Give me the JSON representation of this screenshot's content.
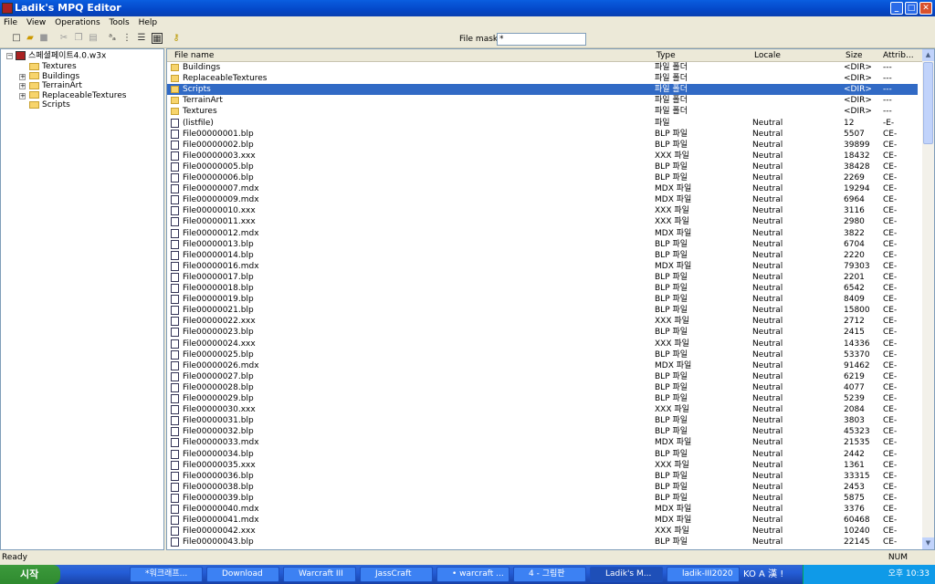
{
  "window": {
    "title": "Ladik's MPQ Editor",
    "min": "_",
    "max": "□",
    "close": "✕"
  },
  "menu": [
    "File",
    "View",
    "Operations",
    "Tools",
    "Help"
  ],
  "toolbar": {
    "icons": [
      "new-icon",
      "open-icon",
      "save-icon",
      "cut-icon",
      "copy-icon",
      "paste-icon",
      "small-icons-icon",
      "list-icon",
      "details-icon",
      "grid-icon",
      "key-icon"
    ],
    "file_mask_label": "File mask :",
    "file_mask_value": "*"
  },
  "tree": {
    "root": "스페셜페이트4.0.w3x",
    "children": [
      {
        "label": "Textures",
        "expandable": false
      },
      {
        "label": "Buildings",
        "expandable": true
      },
      {
        "label": "TerrainArt",
        "expandable": true
      },
      {
        "label": "ReplaceableTextures",
        "expandable": true
      },
      {
        "label": "Scripts",
        "expandable": false
      }
    ]
  },
  "columns": {
    "name": "File name",
    "type": "Type",
    "locale": "Locale",
    "size": "Size",
    "attrib": "Attrib..."
  },
  "rows": [
    {
      "name": "Buildings",
      "type": "파일 폴더",
      "locale": "",
      "size": "<DIR>",
      "attrib": "---",
      "folder": true
    },
    {
      "name": "ReplaceableTextures",
      "type": "파일 폴더",
      "locale": "",
      "size": "<DIR>",
      "attrib": "---",
      "folder": true
    },
    {
      "name": "Scripts",
      "type": "파일 폴더",
      "locale": "",
      "size": "<DIR>",
      "attrib": "---",
      "folder": true,
      "selected": true
    },
    {
      "name": "TerrainArt",
      "type": "파일 폴더",
      "locale": "",
      "size": "<DIR>",
      "attrib": "---",
      "folder": true
    },
    {
      "name": "Textures",
      "type": "파일 폴더",
      "locale": "",
      "size": "<DIR>",
      "attrib": "---",
      "folder": true
    },
    {
      "name": "(listfile)",
      "type": "파일",
      "locale": "Neutral",
      "size": "12",
      "attrib": "-E-"
    },
    {
      "name": "File00000001.blp",
      "type": "BLP 파일",
      "locale": "Neutral",
      "size": "5507",
      "attrib": "CE-"
    },
    {
      "name": "File00000002.blp",
      "type": "BLP 파일",
      "locale": "Neutral",
      "size": "39899",
      "attrib": "CE-"
    },
    {
      "name": "File00000003.xxx",
      "type": "XXX 파일",
      "locale": "Neutral",
      "size": "18432",
      "attrib": "CE-"
    },
    {
      "name": "File00000005.blp",
      "type": "BLP 파일",
      "locale": "Neutral",
      "size": "38428",
      "attrib": "CE-"
    },
    {
      "name": "File00000006.blp",
      "type": "BLP 파일",
      "locale": "Neutral",
      "size": "2269",
      "attrib": "CE-"
    },
    {
      "name": "File00000007.mdx",
      "type": "MDX 파일",
      "locale": "Neutral",
      "size": "19294",
      "attrib": "CE-"
    },
    {
      "name": "File00000009.mdx",
      "type": "MDX 파일",
      "locale": "Neutral",
      "size": "6964",
      "attrib": "CE-"
    },
    {
      "name": "File00000010.xxx",
      "type": "XXX 파일",
      "locale": "Neutral",
      "size": "3116",
      "attrib": "CE-"
    },
    {
      "name": "File00000011.xxx",
      "type": "XXX 파일",
      "locale": "Neutral",
      "size": "2980",
      "attrib": "CE-"
    },
    {
      "name": "File00000012.mdx",
      "type": "MDX 파일",
      "locale": "Neutral",
      "size": "3822",
      "attrib": "CE-"
    },
    {
      "name": "File00000013.blp",
      "type": "BLP 파일",
      "locale": "Neutral",
      "size": "6704",
      "attrib": "CE-"
    },
    {
      "name": "File00000014.blp",
      "type": "BLP 파일",
      "locale": "Neutral",
      "size": "2220",
      "attrib": "CE-"
    },
    {
      "name": "File00000016.mdx",
      "type": "MDX 파일",
      "locale": "Neutral",
      "size": "79303",
      "attrib": "CE-"
    },
    {
      "name": "File00000017.blp",
      "type": "BLP 파일",
      "locale": "Neutral",
      "size": "2201",
      "attrib": "CE-"
    },
    {
      "name": "File00000018.blp",
      "type": "BLP 파일",
      "locale": "Neutral",
      "size": "6542",
      "attrib": "CE-"
    },
    {
      "name": "File00000019.blp",
      "type": "BLP 파일",
      "locale": "Neutral",
      "size": "8409",
      "attrib": "CE-"
    },
    {
      "name": "File00000021.blp",
      "type": "BLP 파일",
      "locale": "Neutral",
      "size": "15800",
      "attrib": "CE-"
    },
    {
      "name": "File00000022.xxx",
      "type": "XXX 파일",
      "locale": "Neutral",
      "size": "2712",
      "attrib": "CE-"
    },
    {
      "name": "File00000023.blp",
      "type": "BLP 파일",
      "locale": "Neutral",
      "size": "2415",
      "attrib": "CE-"
    },
    {
      "name": "File00000024.xxx",
      "type": "XXX 파일",
      "locale": "Neutral",
      "size": "14336",
      "attrib": "CE-"
    },
    {
      "name": "File00000025.blp",
      "type": "BLP 파일",
      "locale": "Neutral",
      "size": "53370",
      "attrib": "CE-"
    },
    {
      "name": "File00000026.mdx",
      "type": "MDX 파일",
      "locale": "Neutral",
      "size": "91462",
      "attrib": "CE-"
    },
    {
      "name": "File00000027.blp",
      "type": "BLP 파일",
      "locale": "Neutral",
      "size": "6219",
      "attrib": "CE-"
    },
    {
      "name": "File00000028.blp",
      "type": "BLP 파일",
      "locale": "Neutral",
      "size": "4077",
      "attrib": "CE-"
    },
    {
      "name": "File00000029.blp",
      "type": "BLP 파일",
      "locale": "Neutral",
      "size": "5239",
      "attrib": "CE-"
    },
    {
      "name": "File00000030.xxx",
      "type": "XXX 파일",
      "locale": "Neutral",
      "size": "2084",
      "attrib": "CE-"
    },
    {
      "name": "File00000031.blp",
      "type": "BLP 파일",
      "locale": "Neutral",
      "size": "3803",
      "attrib": "CE-"
    },
    {
      "name": "File00000032.blp",
      "type": "BLP 파일",
      "locale": "Neutral",
      "size": "45323",
      "attrib": "CE-"
    },
    {
      "name": "File00000033.mdx",
      "type": "MDX 파일",
      "locale": "Neutral",
      "size": "21535",
      "attrib": "CE-"
    },
    {
      "name": "File00000034.blp",
      "type": "BLP 파일",
      "locale": "Neutral",
      "size": "2442",
      "attrib": "CE-"
    },
    {
      "name": "File00000035.xxx",
      "type": "XXX 파일",
      "locale": "Neutral",
      "size": "1361",
      "attrib": "CE-"
    },
    {
      "name": "File00000036.blp",
      "type": "BLP 파일",
      "locale": "Neutral",
      "size": "33315",
      "attrib": "CE-"
    },
    {
      "name": "File00000038.blp",
      "type": "BLP 파일",
      "locale": "Neutral",
      "size": "2453",
      "attrib": "CE-"
    },
    {
      "name": "File00000039.blp",
      "type": "BLP 파일",
      "locale": "Neutral",
      "size": "5875",
      "attrib": "CE-"
    },
    {
      "name": "File00000040.mdx",
      "type": "MDX 파일",
      "locale": "Neutral",
      "size": "3376",
      "attrib": "CE-"
    },
    {
      "name": "File00000041.mdx",
      "type": "MDX 파일",
      "locale": "Neutral",
      "size": "60468",
      "attrib": "CE-"
    },
    {
      "name": "File00000042.xxx",
      "type": "XXX 파일",
      "locale": "Neutral",
      "size": "10240",
      "attrib": "CE-"
    },
    {
      "name": "File00000043.blp",
      "type": "BLP 파일",
      "locale": "Neutral",
      "size": "22145",
      "attrib": "CE-"
    }
  ],
  "status": {
    "text": "Ready",
    "num": "NUM"
  },
  "taskbar": {
    "start": "시작",
    "items": [
      "*워크래프...",
      "Download",
      "Warcraft III",
      "JassCraft",
      "• warcraft ...",
      "4 - 그림판",
      "Ladik's M...",
      "ladik-III2020"
    ],
    "active": 6,
    "lang": "KO A 漢 !",
    "clock": "오후 10:33"
  }
}
